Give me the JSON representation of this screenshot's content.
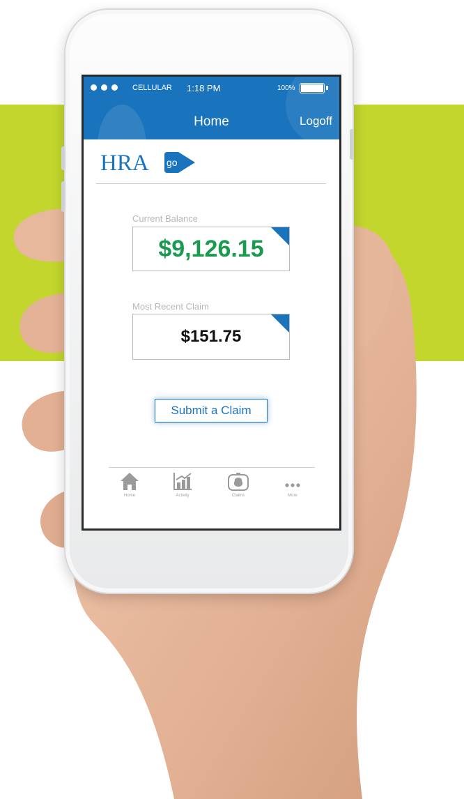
{
  "status_bar": {
    "carrier": "CELLULAR",
    "time": "1:18 PM",
    "battery_percent": "100%",
    "battery_level": 1.0
  },
  "nav": {
    "title": "Home",
    "logoff_label": "Logoff"
  },
  "logo": {
    "text": "HRA",
    "badge": "go"
  },
  "balance": {
    "label": "Current Balance",
    "value": "$9,126.15"
  },
  "recent_claim": {
    "label": "Most Recent Claim",
    "value": "$151.75"
  },
  "submit_button": {
    "label": "Submit a Claim"
  },
  "tabs": [
    {
      "label": "Home",
      "icon": "home-icon"
    },
    {
      "label": "Activity",
      "icon": "activity-chart-icon"
    },
    {
      "label": "Claims",
      "icon": "claims-money-bag-icon"
    },
    {
      "label": "More",
      "icon": "more-dots-icon"
    }
  ],
  "colors": {
    "brand_blue": "#1a73bd",
    "balance_green": "#1a9a4f",
    "background_lime": "#c2d62e"
  }
}
